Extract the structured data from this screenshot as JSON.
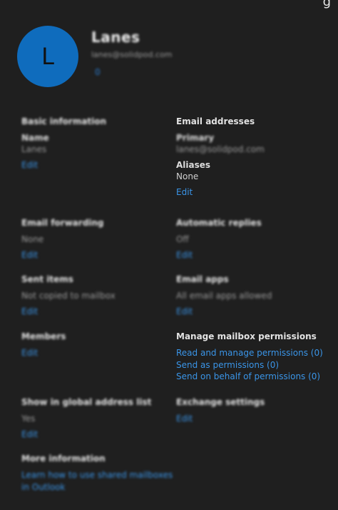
{
  "header": {
    "avatar_letter": "L",
    "name": "Lanes",
    "email": "lanes@solidpod.com",
    "link": "0"
  },
  "left": {
    "basic": {
      "label": "Basic information",
      "sub": "Name",
      "value": "Lanes",
      "edit": "Edit"
    },
    "forwarding": {
      "label": "Email forwarding",
      "value": "None",
      "edit": "Edit"
    },
    "sent_items": {
      "label": "Sent items",
      "value": "Not copied to mailbox",
      "edit": "Edit"
    },
    "members": {
      "label": "Members",
      "edit": "Edit"
    },
    "gal": {
      "label": "Show in global address list",
      "value": "Yes",
      "edit": "Edit"
    },
    "more": {
      "label": "More information",
      "link1": "Learn how to use shared mailboxes",
      "link2": "in Outlook"
    }
  },
  "right": {
    "email_addresses": {
      "label": "Email addresses",
      "primary_label": "Primary",
      "primary_value": "lanes@solidpod.com",
      "aliases_label": "Aliases",
      "aliases_value": "None",
      "edit": "Edit"
    },
    "auto_replies": {
      "label": "Automatic replies",
      "value": "Off",
      "edit": "Edit"
    },
    "email_apps": {
      "label": "Email apps",
      "value": "All email apps allowed",
      "edit": "Edit"
    },
    "permissions": {
      "label": "Manage mailbox permissions",
      "read_manage": "Read and manage permissions (0)",
      "send_as": "Send as permissions (0)",
      "send_on_behalf": "Send on behalf of permissions (0)"
    },
    "exchange": {
      "label": "Exchange settings",
      "edit": "Edit"
    }
  }
}
